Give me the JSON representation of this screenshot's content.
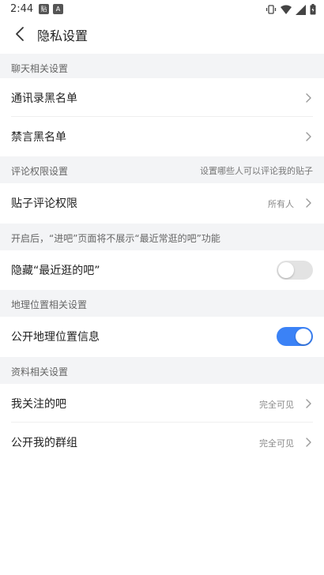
{
  "status_bar": {
    "time": "2:44",
    "app_icon_1": "贴",
    "app_icon_2": "A"
  },
  "nav": {
    "title": "隐私设置"
  },
  "sections": {
    "chat": {
      "title": "聊天相关设置"
    },
    "comment": {
      "title": "评论权限设置",
      "hint": "设置哪些人可以评论我的贴子"
    },
    "visit": {
      "title": "开启后，“进吧”页面将不展示“最近常逛的吧”功能"
    },
    "location": {
      "title": "地理位置相关设置"
    },
    "profile": {
      "title": "资料相关设置"
    }
  },
  "rows": {
    "contacts_blacklist": {
      "label": "通讯录黑名单"
    },
    "mute_blacklist": {
      "label": "禁言黑名单"
    },
    "post_comment_permission": {
      "label": "贴子评论权限",
      "value": "所有人"
    },
    "hide_recent_bars": {
      "label": "隐藏“最近逛的吧”",
      "toggle": "off"
    },
    "public_location": {
      "label": "公开地理位置信息",
      "toggle": "on"
    },
    "followed_bars": {
      "label": "我关注的吧",
      "value": "完全可见"
    },
    "public_groups": {
      "label": "公开我的群组",
      "value": "完全可见"
    }
  },
  "colors": {
    "accent": "#3b82f6",
    "section_bg": "#f3f4f6"
  }
}
